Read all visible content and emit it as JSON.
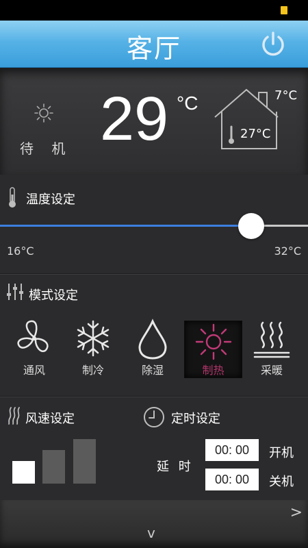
{
  "header": {
    "title": "客厅"
  },
  "status": {
    "mode_text": "待 机",
    "set_temp": "29",
    "unit": "°C",
    "outdoor_temp": "7°C",
    "indoor_temp": "27°C"
  },
  "temperature": {
    "section_title": "温度设定",
    "min_label": "16°C",
    "max_label": "32°C",
    "slider_fraction": 0.815
  },
  "modes": {
    "section_title": "模式设定",
    "items": [
      {
        "label": "通风",
        "icon": "fan-icon"
      },
      {
        "label": "制冷",
        "icon": "snowflake-icon"
      },
      {
        "label": "除湿",
        "icon": "droplet-icon"
      },
      {
        "label": "制热",
        "icon": "sun-icon",
        "active": true
      },
      {
        "label": "采暖",
        "icon": "heating-waves-icon"
      }
    ]
  },
  "fan": {
    "section_title": "风速设定"
  },
  "timer": {
    "section_title": "定时设定",
    "delay_label": "延 时",
    "on_value": "00: 00",
    "on_label": "开机",
    "off_value": "00: 00",
    "off_label": "关机"
  },
  "footer": {
    "right_chevron": ">",
    "down_chevron": "v"
  },
  "colors": {
    "header": "#4aa8e0",
    "slider_fill": "#3d7fe0",
    "active_mode": "#b0346a"
  }
}
